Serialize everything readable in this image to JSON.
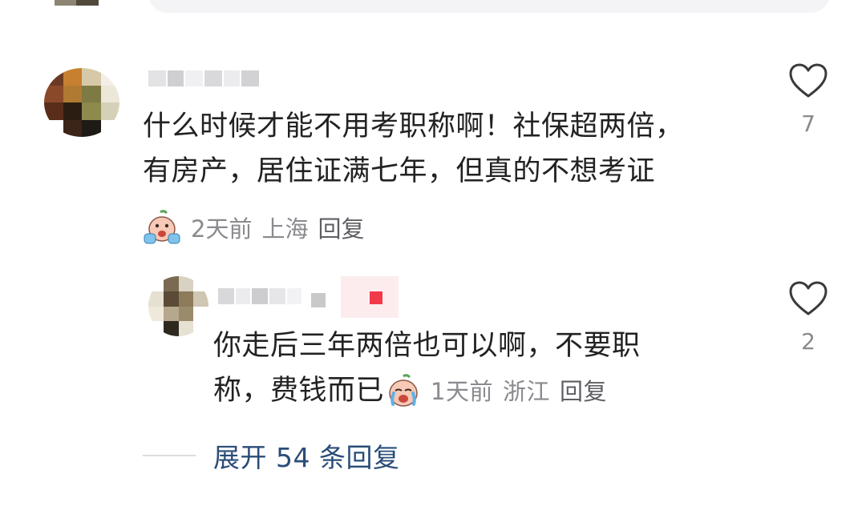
{
  "comment": {
    "text_lines": [
      "什么时候才能不用考职称啊！社保超两倍，",
      "有房产，居住证满七年，但真的不想考证"
    ],
    "time": "2天前",
    "location": "上海",
    "reply_label": "回复",
    "like_count": "7",
    "emoji_icon": "crying-face-emoji-icon",
    "heart_icon": "heart-outline-icon"
  },
  "reply": {
    "text_line1": "你走后三年两倍也可以啊，不要职",
    "text_line2": "称，费钱而已",
    "time": "1天前",
    "location": "浙江",
    "reply_label": "回复",
    "like_count": "2",
    "emoji_icon": "crying-face-emoji-icon"
  },
  "expand": {
    "label": "展开 54 条回复"
  },
  "colors": {
    "text": "#222222",
    "meta": "#8a8a8f",
    "link": "#2a4d78",
    "badge_red": "#f2394a"
  }
}
